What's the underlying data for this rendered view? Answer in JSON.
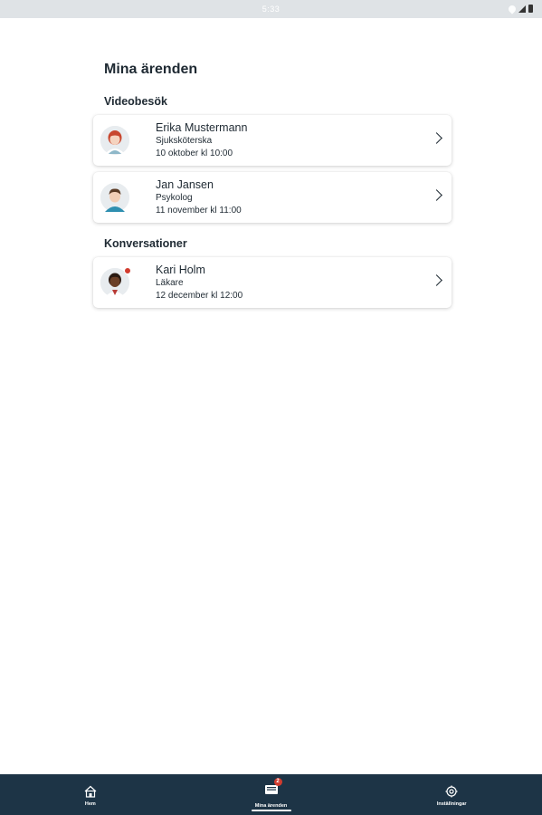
{
  "status_bar": {
    "time": "5:33"
  },
  "page": {
    "title": "Mina ärenden"
  },
  "sections": {
    "video": {
      "title": "Videobesök",
      "items": [
        {
          "name": "Erika Mustermann",
          "role": "Sjuksköterska",
          "time": "10 oktober kl 10:00",
          "avatar": "avatar-red-hair-female"
        },
        {
          "name": "Jan Jansen",
          "role": "Psykolog",
          "time": "11 november kl 11:00",
          "avatar": "avatar-brown-hair-male"
        }
      ]
    },
    "conversations": {
      "title": "Konversationer",
      "items": [
        {
          "name": "Kari Holm",
          "role": "Läkare",
          "time": "12 december kl 12:00",
          "avatar": "avatar-dark-hair-doctor",
          "unread": true
        }
      ]
    }
  },
  "bottom_nav": {
    "items": [
      {
        "label": "Hem",
        "icon": "home-icon",
        "active": false
      },
      {
        "label": "Mina ärenden",
        "icon": "inbox-icon",
        "active": true,
        "badge": "2"
      },
      {
        "label": "Inställningar",
        "icon": "gear-icon",
        "active": false
      }
    ]
  },
  "colors": {
    "nav_bg": "#1d3446",
    "badge": "#d13c2f",
    "text": "#1f2a33"
  }
}
